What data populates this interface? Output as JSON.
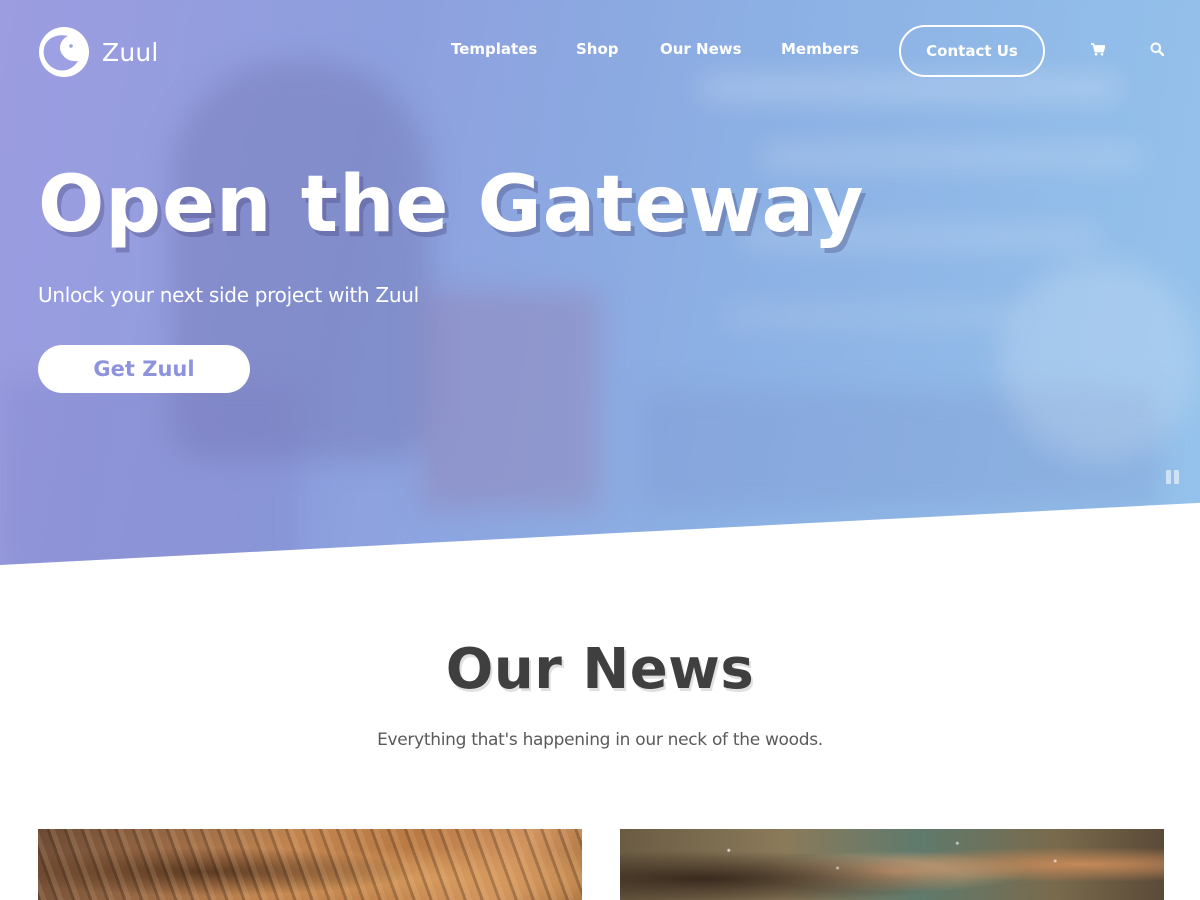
{
  "brand": {
    "name": "Zuul",
    "logo_icon": "moon-face-logo"
  },
  "nav": {
    "items": [
      {
        "label": "Templates"
      },
      {
        "label": "Shop"
      },
      {
        "label": "Our News"
      },
      {
        "label": "Members"
      }
    ],
    "contact_label": "Contact Us",
    "cart_icon": "cart-icon",
    "search_icon": "search-icon"
  },
  "hero": {
    "title": "Open the Gateway",
    "subtitle": "Unlock your next side project with Zuul",
    "cta_label": "Get Zuul",
    "pause_icon": "pause-icon"
  },
  "news": {
    "title": "Our News",
    "subtitle": "Everything that's happening in our neck of the woods."
  },
  "colors": {
    "hero_gradient_start": "#9c9ce0",
    "hero_gradient_end": "#95c3ec",
    "cta_text": "#8d94dc",
    "heading_text": "#3f3f3f"
  }
}
